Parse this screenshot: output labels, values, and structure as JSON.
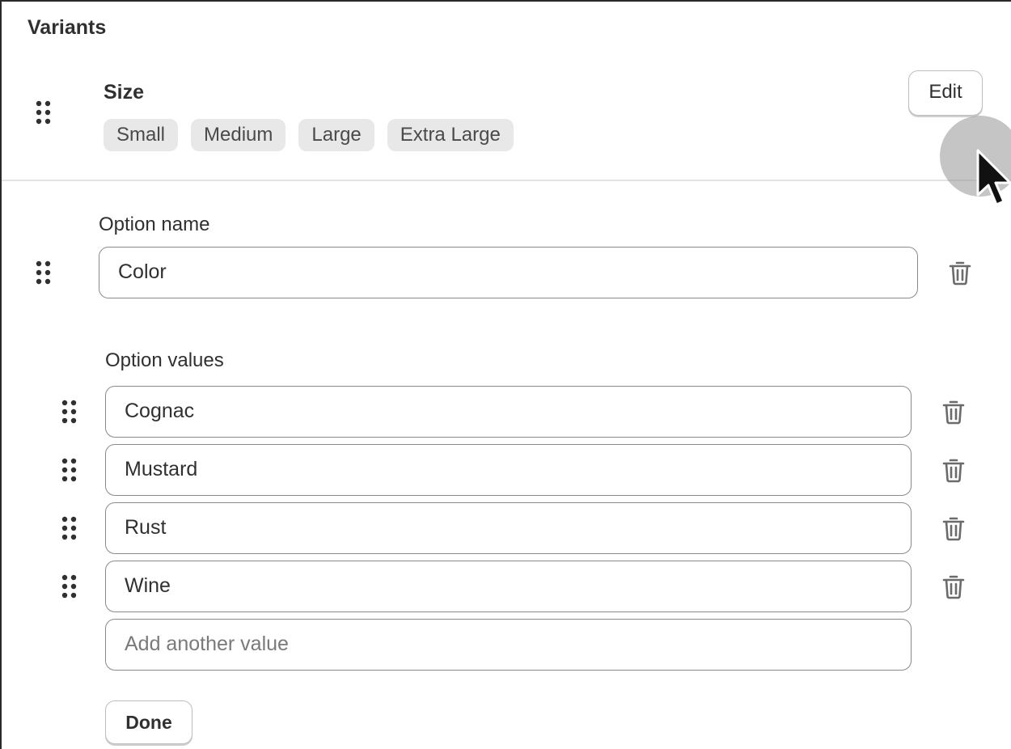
{
  "card": {
    "title": "Variants"
  },
  "size_option": {
    "name": "Size",
    "values": [
      "Small",
      "Medium",
      "Large",
      "Extra Large"
    ],
    "edit_label": "Edit"
  },
  "color_option": {
    "name_label": "Option name",
    "name_value": "Color",
    "values_label": "Option values",
    "values": [
      "Cognac",
      "Mustard",
      "Rust",
      "Wine"
    ],
    "add_placeholder": "Add another value",
    "done_label": "Done"
  },
  "icons": {
    "drag_handle": "drag-handle-icon",
    "delete": "trash-icon",
    "cursor": "mouse-pointer-icon"
  },
  "colors": {
    "text": "#303030",
    "chip_bg": "#e8e8e8",
    "field_border": "#8a8a8a",
    "icon": "#6b6b6b"
  }
}
